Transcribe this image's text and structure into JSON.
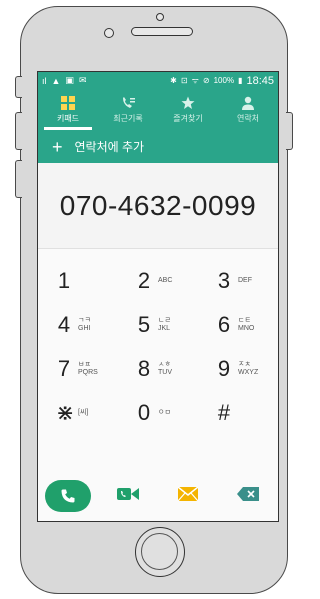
{
  "status_bar": {
    "left_icons": [
      "il",
      "warning-icon",
      "image-icon",
      "mail-icon"
    ],
    "right_text": "100%",
    "time": "18:45"
  },
  "tabs": [
    {
      "label": "키패드",
      "icon": "keypad-icon",
      "active": true
    },
    {
      "label": "최근기록",
      "icon": "call-log-icon",
      "active": false
    },
    {
      "label": "즐겨찾기",
      "icon": "star-icon",
      "active": false
    },
    {
      "label": "연락처",
      "icon": "person-icon",
      "active": false
    }
  ],
  "add_contact": {
    "label": "연락처에 추가"
  },
  "dialed_number": "070-4632-0099",
  "keypad": [
    [
      {
        "digit": "1",
        "sub1": "",
        "sub2": ""
      },
      {
        "digit": "2",
        "sub1": "",
        "sub2": "ABC"
      },
      {
        "digit": "3",
        "sub1": "",
        "sub2": "DEF"
      }
    ],
    [
      {
        "digit": "4",
        "sub1": "ㄱㅋ",
        "sub2": "GHI"
      },
      {
        "digit": "5",
        "sub1": "ㄴㄹ",
        "sub2": "JKL"
      },
      {
        "digit": "6",
        "sub1": "ㄷㅌ",
        "sub2": "MNO"
      }
    ],
    [
      {
        "digit": "7",
        "sub1": "ㅂㅍ",
        "sub2": "PQRS"
      },
      {
        "digit": "8",
        "sub1": "ㅅㅎ",
        "sub2": "TUV"
      },
      {
        "digit": "9",
        "sub1": "ㅈㅊ",
        "sub2": "WXYZ"
      }
    ],
    [
      {
        "digit": "⋇",
        "sub1": "",
        "sub2": "[씨]"
      },
      {
        "digit": "0",
        "sub1": "ㅇㅁ",
        "sub2": ""
      },
      {
        "digit": "#",
        "sub1": "",
        "sub2": ""
      }
    ]
  ],
  "colors": {
    "accent": "#2aa58a",
    "call": "#20a06b",
    "video": "#20a06b",
    "message": "#f4b400",
    "delete": "#3a8f8a"
  }
}
